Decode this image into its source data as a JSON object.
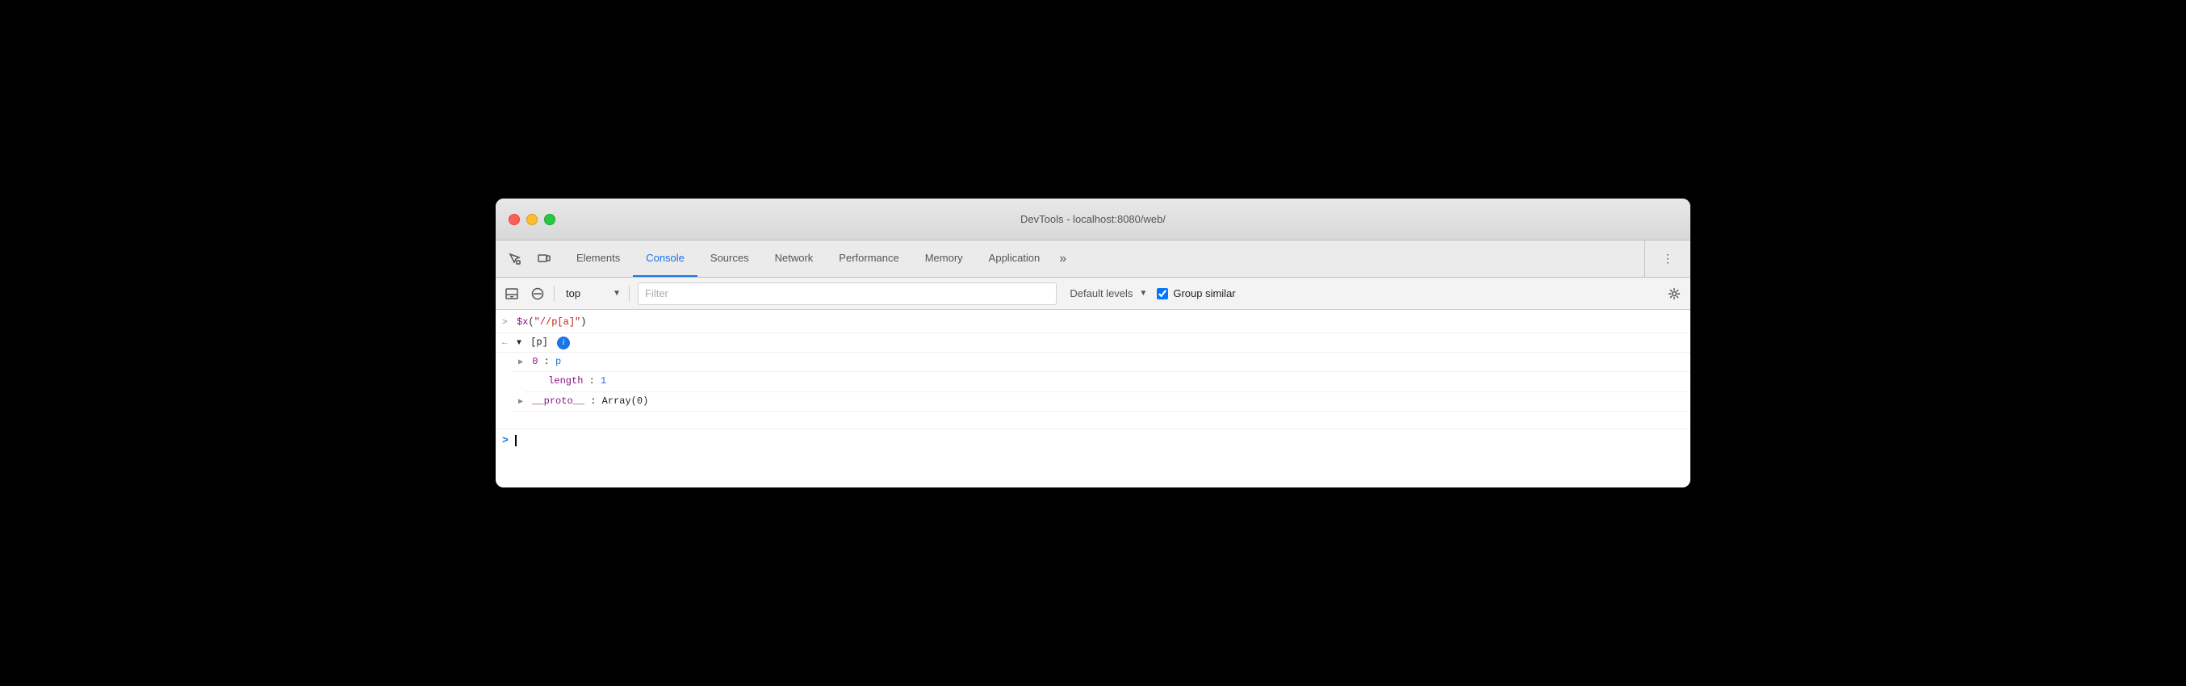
{
  "window": {
    "title": "DevTools - localhost:8080/web/"
  },
  "tabbar": {
    "tabs": [
      {
        "id": "elements",
        "label": "Elements",
        "active": false
      },
      {
        "id": "console",
        "label": "Console",
        "active": true
      },
      {
        "id": "sources",
        "label": "Sources",
        "active": false
      },
      {
        "id": "network",
        "label": "Network",
        "active": false
      },
      {
        "id": "performance",
        "label": "Performance",
        "active": false
      },
      {
        "id": "memory",
        "label": "Memory",
        "active": false
      },
      {
        "id": "application",
        "label": "Application",
        "active": false
      }
    ],
    "more_label": "»",
    "menu_icon": "⋮"
  },
  "console_toolbar": {
    "context_value": "top",
    "filter_placeholder": "Filter",
    "levels_label": "Default levels",
    "group_similar_label": "Group similar",
    "group_similar_checked": true
  },
  "console": {
    "entries": [
      {
        "type": "input",
        "arrow": ">",
        "code": "$x(\"//p[a]\")"
      },
      {
        "type": "output_collapsed",
        "back_arrow": "←",
        "expand_arrow": "▼",
        "label": "[p]",
        "has_info": true
      },
      {
        "type": "output_child",
        "indent": 1,
        "expand_arrow": "▶",
        "key": "0",
        "value": "p",
        "key_color": "purple",
        "value_color": "blue"
      },
      {
        "type": "output_prop",
        "indent": 1,
        "key": "length",
        "value": "1",
        "key_color": "purple",
        "value_color": "blue"
      },
      {
        "type": "output_child",
        "indent": 1,
        "expand_arrow": "▶",
        "key": "__proto__",
        "value": "Array(0)",
        "key_color": "purple",
        "value_color": "dark"
      }
    ],
    "input_prompt": ">",
    "cursor_char": "|"
  }
}
